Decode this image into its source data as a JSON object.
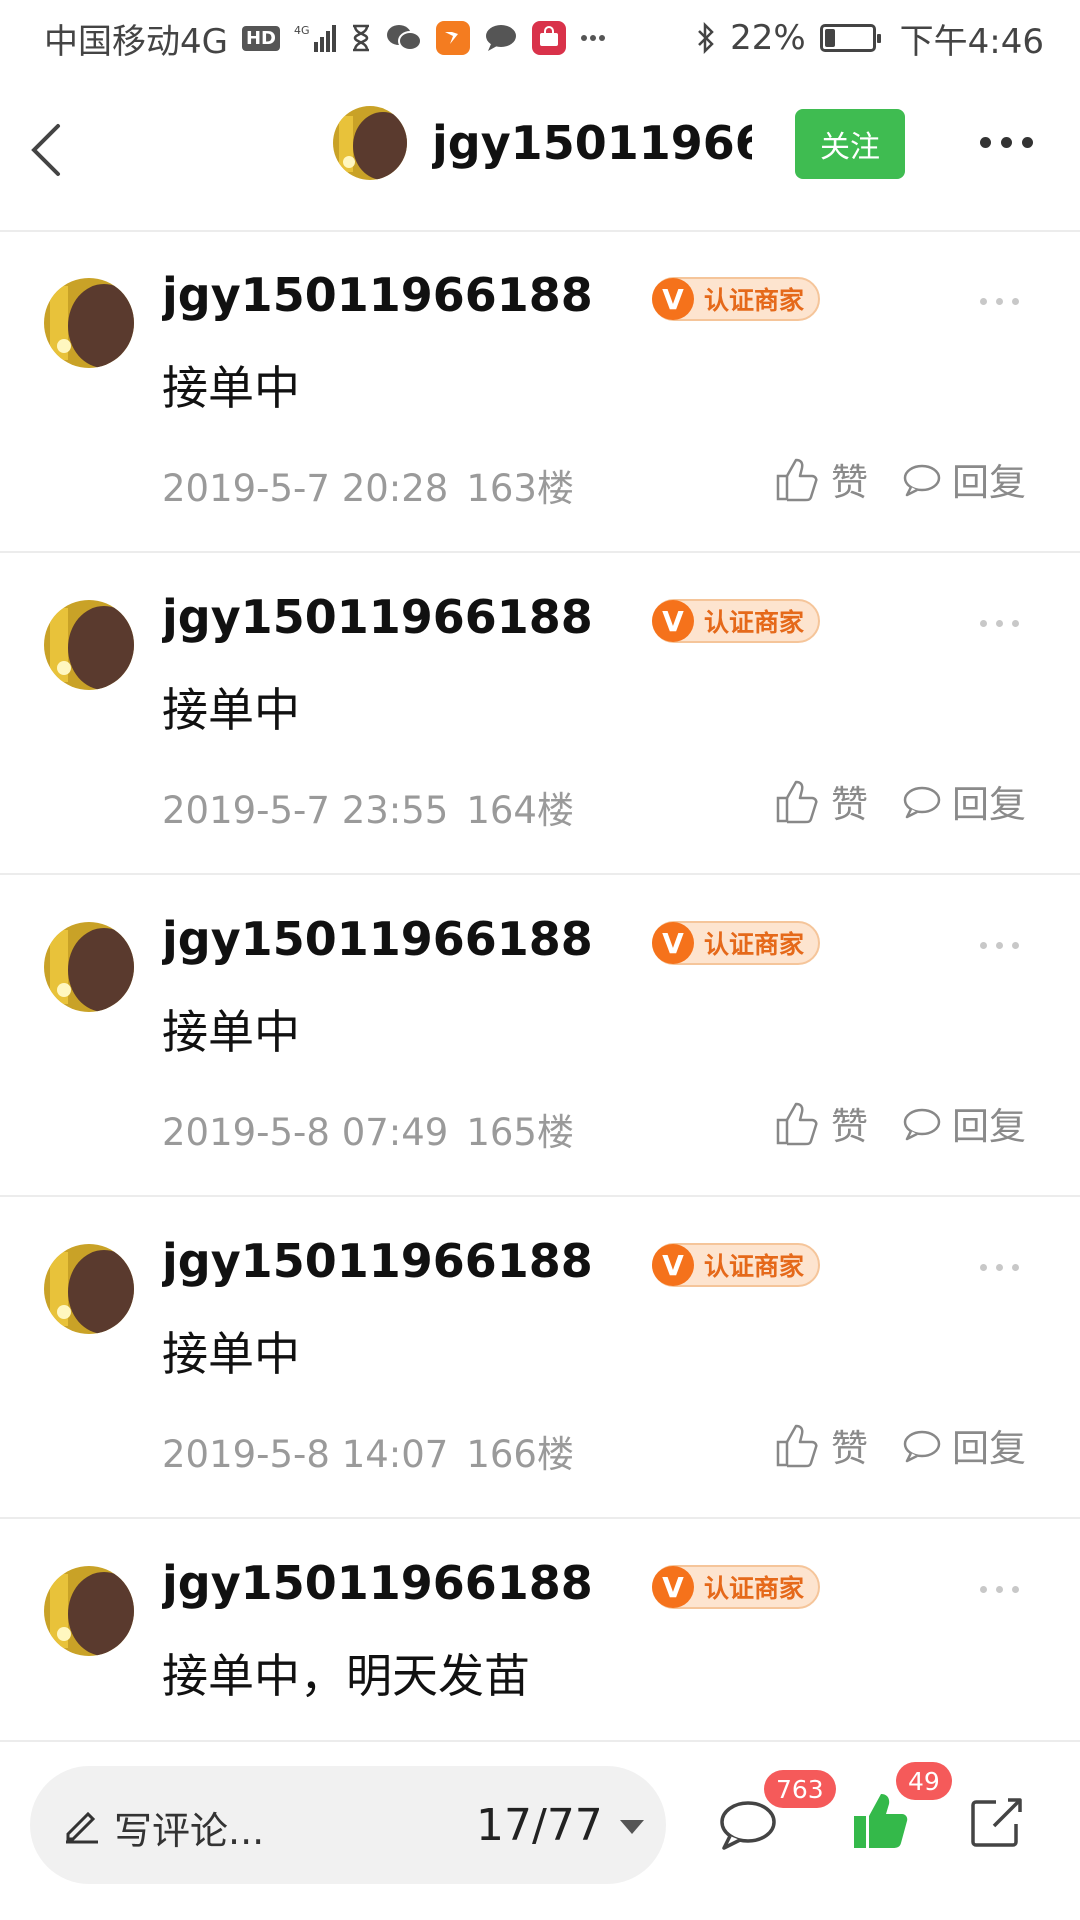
{
  "status_bar": {
    "carrier": "中国移动4G",
    "hd": "HD",
    "network": "4G",
    "battery_percent": "22%",
    "battery_level": 0.22,
    "time": "下午4:46",
    "icons": [
      "hourglass-icon",
      "wechat-icon",
      "app-icon",
      "message-icon",
      "tmall-icon",
      "more-icon",
      "bluetooth-icon"
    ]
  },
  "header": {
    "username": "jgy15011966…",
    "follow_label": "关注"
  },
  "posts": [
    {
      "username": "jgy15011966188 (…",
      "badge_v": "V",
      "badge": "认证商家",
      "content": "接单中",
      "date": "2019-5-7 20:28",
      "floor": "163楼",
      "like_label": "赞",
      "reply_label": "回复"
    },
    {
      "username": "jgy15011966188 (…",
      "badge_v": "V",
      "badge": "认证商家",
      "content": "接单中",
      "date": "2019-5-7 23:55",
      "floor": "164楼",
      "like_label": "赞",
      "reply_label": "回复"
    },
    {
      "username": "jgy15011966188 (…",
      "badge_v": "V",
      "badge": "认证商家",
      "content": "接单中",
      "date": "2019-5-8 07:49",
      "floor": "165楼",
      "like_label": "赞",
      "reply_label": "回复"
    },
    {
      "username": "jgy15011966188 (…",
      "badge_v": "V",
      "badge": "认证商家",
      "content": "接单中",
      "date": "2019-5-8 14:07",
      "floor": "166楼",
      "like_label": "赞",
      "reply_label": "回复"
    },
    {
      "username": "jgy15011966188 (…",
      "badge_v": "V",
      "badge": "认证商家",
      "content": "接单中，明天发苗",
      "date": "",
      "floor": "",
      "like_label": "",
      "reply_label": ""
    }
  ],
  "bottom_bar": {
    "comment_placeholder": "写评论...",
    "page_indicator": "17/77",
    "comment_count": "763",
    "like_count": "49"
  },
  "colors": {
    "follow_green": "#3fbc51",
    "badge_orange": "#f5721b",
    "count_red": "#f55a5a",
    "like_green": "#34b94a"
  }
}
